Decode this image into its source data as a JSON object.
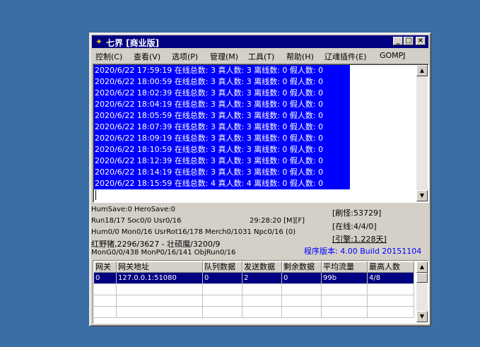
{
  "window": {
    "title": "七界 [商业版]"
  },
  "menu": [
    "控制(C)",
    "查看(V)",
    "选项(P)",
    "管理(M)",
    "工具(T)",
    "帮助(H)",
    "辽魂插件(E)",
    "GOMPJ"
  ],
  "log": [
    "2020/6/22 17:59:19 在线总数: 3 真人数: 3 离线数: 0 假人数: 0",
    "2020/6/22 18:00:59 在线总数: 3 真人数: 3 离线数: 0 假人数: 0",
    "2020/6/22 18:02:39 在线总数: 3 真人数: 3 离线数: 0 假人数: 0",
    "2020/6/22 18:04:19 在线总数: 3 真人数: 3 离线数: 0 假人数: 0",
    "2020/6/22 18:05:59 在线总数: 3 真人数: 3 离线数: 0 假人数: 0",
    "2020/6/22 18:07:39 在线总数: 3 真人数: 3 离线数: 0 假人数: 0",
    "2020/6/22 18:09:19 在线总数: 3 真人数: 3 离线数: 0 假人数: 0",
    "2020/6/22 18:10:59 在线总数: 3 真人数: 3 离线数: 0 假人数: 0",
    "2020/6/22 18:12:39 在线总数: 3 真人数: 3 离线数: 0 假人数: 0",
    "2020/6/22 18:14:19 在线总数: 3 真人数: 3 离线数: 0 假人数: 0",
    "2020/6/22 18:15:59 在线总数: 4 真人数: 4 离线数: 0 假人数: 0"
  ],
  "stats": {
    "line1": "HumSave:0 HeroSave:0",
    "line2": "Run18/17 Soc0/0 Usr0/16",
    "time": "29:28:20 [M][F]",
    "line3": "Hum0/0 Mon0/16 UsrRot16/178 Merch0/1031 Npc0/16 (0)",
    "line4": "红野猪,2296/3627 - 壮硕魔/3200/9",
    "line5": "MonG0/0/438 MonP0/16/141 ObjRun0/16",
    "refresh": "[刷怪:53729]",
    "online": "[在线:4/4/0]",
    "engine": "[引擎:1.228天]",
    "version": "程序版本: 4.00 Build 20151104"
  },
  "table": {
    "headers": [
      "网关",
      "网关地址",
      "队列数据",
      "发送数据",
      "剩余数据",
      "平均流量",
      "最高人数"
    ],
    "rows": [
      [
        "0",
        "127.0.0.1:51080",
        "0",
        "2",
        "0",
        "99b",
        "4/8"
      ]
    ]
  },
  "colors": {
    "desktop": "#3a6ea5",
    "title": "#000080",
    "log_highlight": "#0000ff",
    "version_text": "#0000ff"
  }
}
